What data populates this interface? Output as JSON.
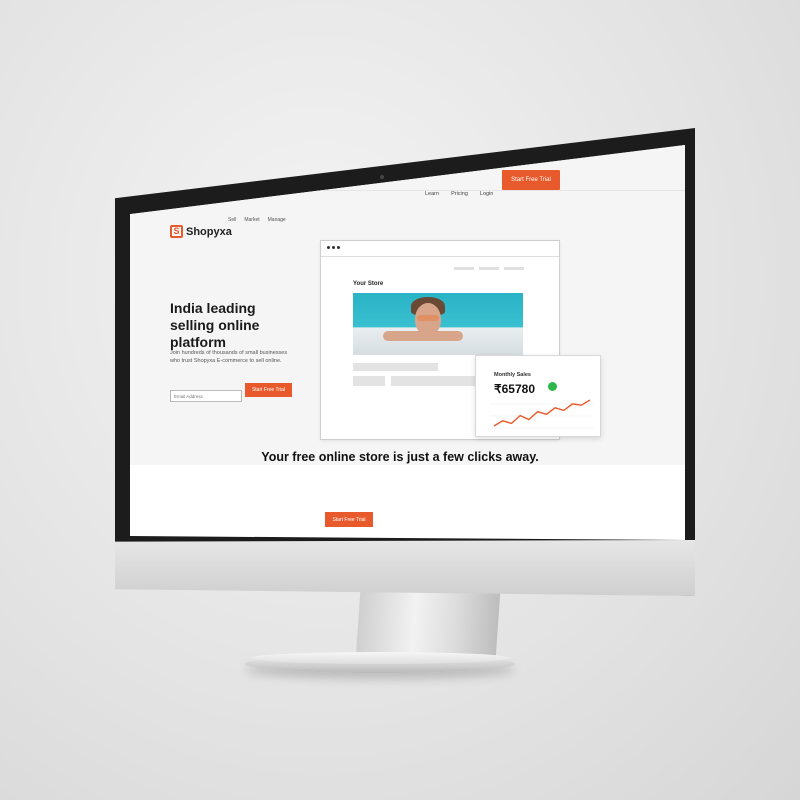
{
  "brand": {
    "name": "Shopyxa",
    "mark": "S",
    "accent": "#e85a2b"
  },
  "subnav": [
    "Sell",
    "Market",
    "Manage"
  ],
  "topnav": {
    "learn": "Learn",
    "pricing": "Pricing",
    "login": "Login",
    "cta": "Start Free Trial"
  },
  "hero": {
    "title": "India leading selling online platform",
    "subtitle": "Join hundreds of thousands of small businesses who trust Shopyxa E-commerce to sell online.",
    "email_placeholder": "Email Address",
    "cta": "Start Free Trial"
  },
  "store_mockup": {
    "title": "Your Store"
  },
  "sales_card": {
    "label": "Monthly Sales",
    "value": "₹65780",
    "status_color": "#2db84b",
    "trend": [
      10,
      14,
      12,
      18,
      15,
      21,
      19,
      24,
      22,
      27,
      26,
      30
    ]
  },
  "bottom": {
    "title": "Your free online store is just a few clicks away.",
    "cta": "Start Free Trial"
  }
}
